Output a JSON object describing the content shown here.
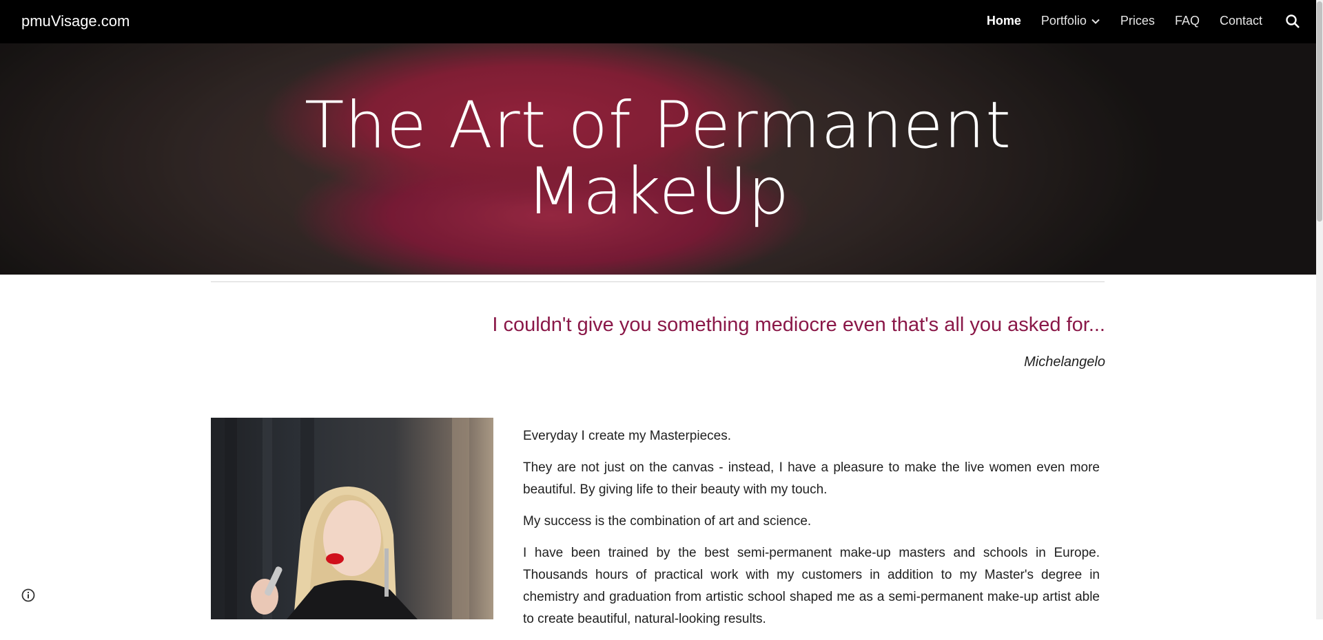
{
  "site": {
    "title": "pmuVisage.com"
  },
  "nav": {
    "items": [
      {
        "label": "Home"
      },
      {
        "label": "Portfolio"
      },
      {
        "label": "Prices"
      },
      {
        "label": "FAQ"
      },
      {
        "label": "Contact"
      }
    ],
    "active": "Home"
  },
  "hero": {
    "title_line1": "The Art of Permanent",
    "title_line2": "MakeUp"
  },
  "quote": {
    "text": "I couldn't give you something mediocre even that's all you asked for...",
    "author": "Michelangelo"
  },
  "body": {
    "paragraphs": [
      "Everyday I create my Masterpieces.",
      "They are not just on the canvas - instead, I have a pleasure to make the live women even more beautiful. By giving life to their beauty with my touch.",
      "My success is the combination of art and science.",
      "I have been trained by the best semi-permanent make-up masters and schools in Europe. Thousands hours of practical work with my customers in addition to my Master's degree in chemistry and graduation from artistic school  shaped me as a semi-permanent make-up artist able to create beautiful, natural-looking results."
    ]
  },
  "colors": {
    "nav_bg": "#000000",
    "accent_quote": "#8a1848"
  },
  "icons": [
    "chevron-down-icon",
    "search-icon",
    "info-icon"
  ]
}
